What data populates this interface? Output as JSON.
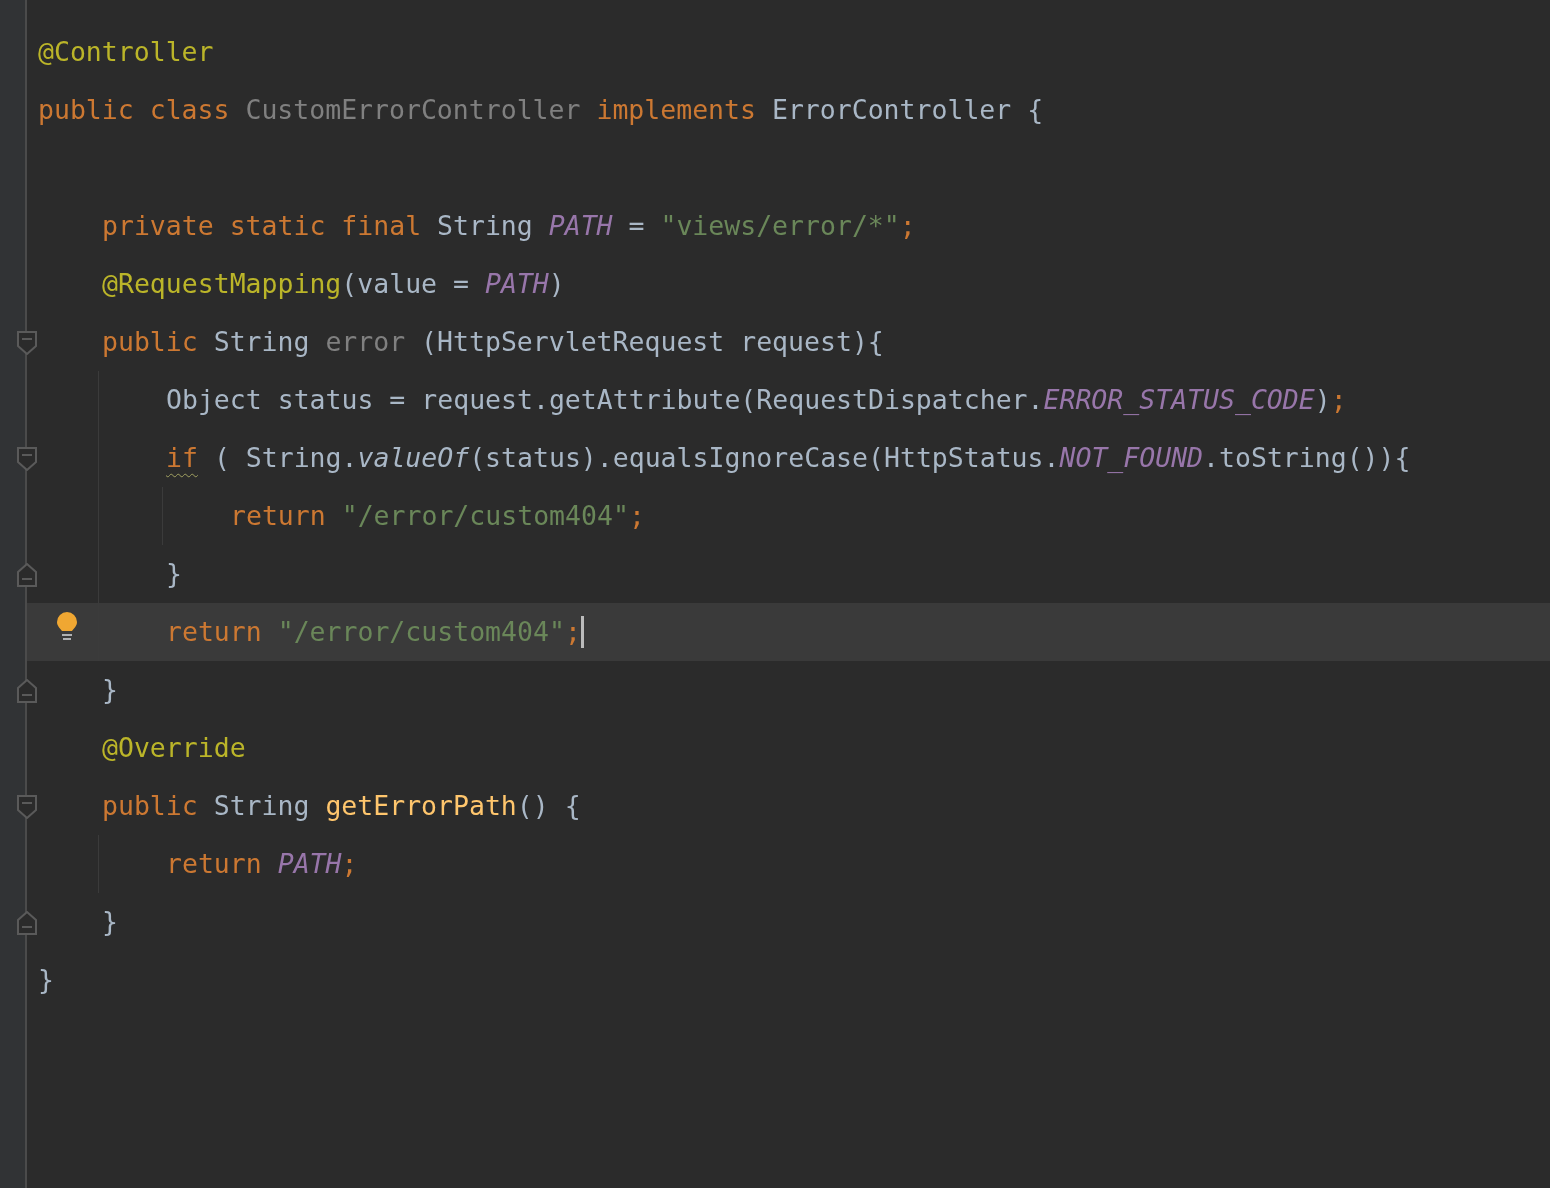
{
  "editor": {
    "lines": [
      {
        "kind": "code",
        "tokens": [
          {
            "kind": "annotation",
            "text": "@Controller"
          }
        ]
      },
      {
        "kind": "code",
        "tokens": [
          {
            "kind": "keyword",
            "text": "public class "
          },
          {
            "kind": "unused",
            "text": "CustomErrorController "
          },
          {
            "kind": "keyword",
            "text": "implements"
          },
          {
            "kind": "plain",
            "text": " ErrorController {"
          }
        ],
        "children": [
          {
            "kind": "blank"
          },
          {
            "kind": "code",
            "tokens": [
              {
                "kind": "keyword",
                "text": "private static final"
              },
              {
                "kind": "plain",
                "text": " String "
              },
              {
                "kind": "constant",
                "text": "PATH"
              },
              {
                "kind": "plain",
                "text": " = "
              },
              {
                "kind": "string",
                "text": "\"views/error/*\""
              },
              {
                "kind": "keyword",
                "text": ";"
              }
            ]
          },
          {
            "kind": "code",
            "tokens": [
              {
                "kind": "annotation",
                "text": "@RequestMapping"
              },
              {
                "kind": "plain",
                "text": "(value = "
              },
              {
                "kind": "constant",
                "text": "PATH"
              },
              {
                "kind": "plain",
                "text": ")"
              }
            ]
          },
          {
            "kind": "code",
            "fold_start": true,
            "tokens": [
              {
                "kind": "keyword",
                "text": "public"
              },
              {
                "kind": "plain",
                "text": " String "
              },
              {
                "kind": "unused",
                "text": "error"
              },
              {
                "kind": "plain",
                "text": " (HttpServletRequest request){"
              }
            ],
            "children": [
              {
                "kind": "code",
                "tokens": [
                  {
                    "kind": "plain",
                    "text": "Object status = request.getAttribute(RequestDispatcher."
                  },
                  {
                    "kind": "constant",
                    "text": "ERROR_STATUS_CODE"
                  },
                  {
                    "kind": "plain",
                    "text": ")"
                  },
                  {
                    "kind": "keyword",
                    "text": ";"
                  }
                ]
              },
              {
                "kind": "code",
                "fold_start": true,
                "tokens": [
                  {
                    "kind": "keyword",
                    "text": "if",
                    "warning": true
                  },
                  {
                    "kind": "plain",
                    "text": " ( String."
                  },
                  {
                    "kind": "static",
                    "text": "valueOf"
                  },
                  {
                    "kind": "plain",
                    "text": "(status).equalsIgnoreCase(HttpStatus."
                  },
                  {
                    "kind": "constant",
                    "text": "NOT_FOUND"
                  },
                  {
                    "kind": "plain",
                    "text": ".toString()){"
                  }
                ],
                "children": [
                  {
                    "kind": "code",
                    "tokens": [
                      {
                        "kind": "keyword",
                        "text": "return "
                      },
                      {
                        "kind": "string",
                        "text": "\"/error/custom404\""
                      },
                      {
                        "kind": "keyword",
                        "text": ";"
                      }
                    ]
                  }
                ]
              },
              {
                "kind": "code",
                "fold_end": true,
                "tokens": [
                  {
                    "kind": "plain",
                    "text": "}"
                  }
                ]
              },
              {
                "kind": "code",
                "current": true,
                "bulb": true,
                "caret": true,
                "tokens": [
                  {
                    "kind": "keyword",
                    "text": "return "
                  },
                  {
                    "kind": "string",
                    "text": "\"/error/custom404\""
                  },
                  {
                    "kind": "keyword",
                    "text": ";"
                  }
                ]
              }
            ]
          },
          {
            "kind": "code",
            "fold_end": true,
            "tokens": [
              {
                "kind": "plain",
                "text": "}"
              }
            ]
          },
          {
            "kind": "code",
            "tokens": [
              {
                "kind": "annotation",
                "text": "@Override"
              }
            ]
          },
          {
            "kind": "code",
            "fold_start": true,
            "tokens": [
              {
                "kind": "keyword",
                "text": "public"
              },
              {
                "kind": "plain",
                "text": " String "
              },
              {
                "kind": "method",
                "text": "getErrorPath"
              },
              {
                "kind": "plain",
                "text": "() {"
              }
            ],
            "children": [
              {
                "kind": "code",
                "tokens": [
                  {
                    "kind": "keyword",
                    "text": "return "
                  },
                  {
                    "kind": "constant",
                    "text": "PATH"
                  },
                  {
                    "kind": "keyword",
                    "text": ";"
                  }
                ]
              }
            ]
          },
          {
            "kind": "code",
            "fold_end": true,
            "tokens": [
              {
                "kind": "plain",
                "text": "}"
              }
            ]
          }
        ]
      },
      {
        "kind": "code",
        "tokens": [
          {
            "kind": "plain",
            "text": "}"
          }
        ]
      }
    ]
  }
}
